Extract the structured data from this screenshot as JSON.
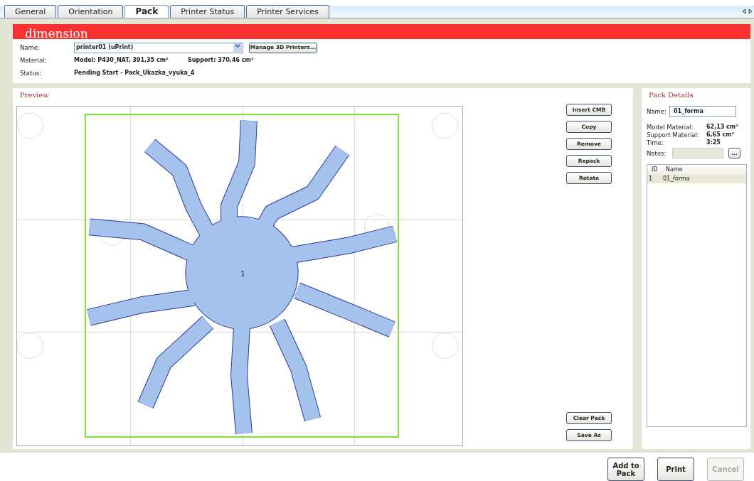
{
  "tabs": [
    {
      "label": "General",
      "selected": false
    },
    {
      "label": "Orientation",
      "selected": false
    },
    {
      "label": "Pack",
      "selected": true
    },
    {
      "label": "Printer Status",
      "selected": false
    },
    {
      "label": "Printer Services",
      "selected": false
    }
  ],
  "header": {
    "logo": "dimension",
    "fields": [
      {
        "kind": "select",
        "label": "Name:",
        "value": "printer01  (uPrint)",
        "button": "Manage 3D Printers..."
      },
      {
        "kind": "pair",
        "label": "Material:",
        "value": "Model: P430_NAT, 391,35 cm²",
        "value_2": "Support: 370,46 cm²"
      },
      {
        "kind": "text",
        "label": "Status:",
        "value": "Pending Start - Pack_Ukazka_vyuka_4"
      }
    ]
  },
  "preview": {
    "title": "Preview",
    "part_label": "1",
    "top_buttons": [
      "Insert CMB",
      "Copy",
      "Remove",
      "Repack",
      "Rotate"
    ],
    "bottom_buttons": [
      "Clear Pack",
      "Save As"
    ]
  },
  "pack_details": {
    "title": "Pack Details",
    "name_label": "Name:",
    "name_value": "01_forma",
    "stats": [
      {
        "label": "Model Material:",
        "value": "62,13 cm³"
      },
      {
        "label": "Support Material:",
        "value": "6,65 cm³"
      },
      {
        "label": "Time:",
        "value": "3:25"
      }
    ],
    "notes_label": "Notes:",
    "notes_button": "...",
    "table": {
      "columns": [
        "ID",
        "Name"
      ],
      "rows": [
        {
          "cells": [
            "1",
            "01_forma"
          ],
          "selected": true
        }
      ]
    }
  },
  "footer": {
    "buttons": [
      {
        "label": "Add to\nPack",
        "disabled": false
      },
      {
        "label": "Print",
        "disabled": false
      },
      {
        "label": "Cancel",
        "disabled": true
      }
    ]
  }
}
